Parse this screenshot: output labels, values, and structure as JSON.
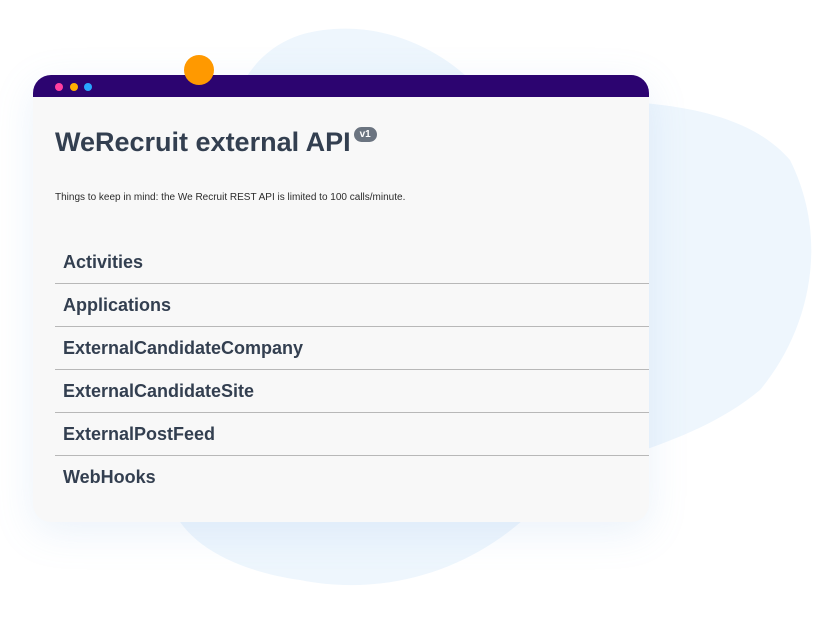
{
  "colors": {
    "titlebar": "#2c0470",
    "dot_red": "#ff3fa0",
    "dot_yellow": "#ffb000",
    "dot_blue": "#29a7ff",
    "orange_ball": "#ff9900",
    "blob": "#eef6fd"
  },
  "window": {
    "controls": [
      "close-dot",
      "minimize-dot",
      "maximize-dot"
    ]
  },
  "page": {
    "title": "WeRecruit external API",
    "version_badge": "v1",
    "note": "Things to keep in mind: the We Recruit REST API is limited to 100 calls/minute."
  },
  "sections": [
    {
      "label": "Activities"
    },
    {
      "label": "Applications"
    },
    {
      "label": "ExternalCandidateCompany"
    },
    {
      "label": "ExternalCandidateSite"
    },
    {
      "label": "ExternalPostFeed"
    },
    {
      "label": "WebHooks"
    }
  ]
}
